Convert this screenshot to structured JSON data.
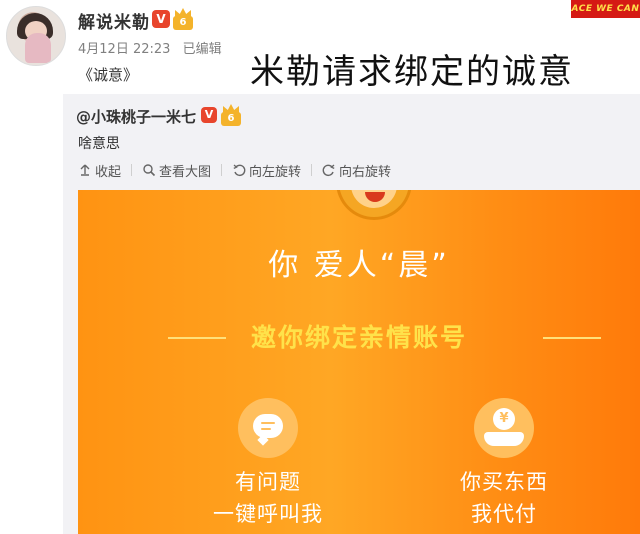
{
  "post": {
    "author": "解说米勒",
    "v_badge": "V",
    "level_badge": "6",
    "timestamp": "4月12日 22:23",
    "edited": "已编辑",
    "text": "《诚意》"
  },
  "caption": "米勒请求绑定的诚意",
  "logo": "ACE WE CAN",
  "repost": {
    "author": "@小珠桃子一米七",
    "v_badge": "V",
    "level_badge": "6",
    "text": "啥意思"
  },
  "toolbar": {
    "collapse": "收起",
    "view_large": "查看大图",
    "rotate_left": "向左旋转",
    "rotate_right": "向右旋转"
  },
  "image": {
    "title": "你 爱人“晨”",
    "subtitle": "邀你绑定亲情账号",
    "coin_symbol": "¥",
    "option1": {
      "line1": "有问题",
      "line2": "一键呼叫我"
    },
    "option2": {
      "line1": "你买东西",
      "line2": "我代付"
    }
  },
  "colors": {
    "orange_left": "#ff9312",
    "orange_right": "#ff7a0a",
    "subtitle_yellow": "#ffe24a",
    "v_badge_red": "#e8452c"
  }
}
